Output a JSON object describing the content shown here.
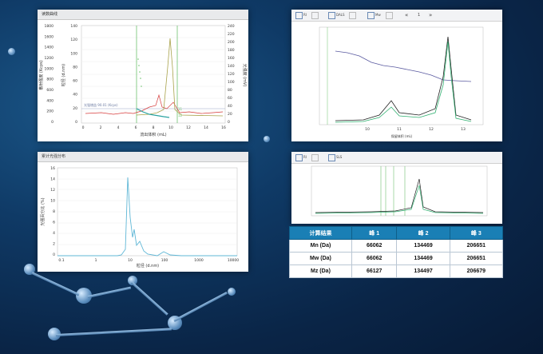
{
  "panels": {
    "chromatogram": {
      "title": "读数曲线",
      "left_axis_label": "散射强度 (Kcps)",
      "mid_axis_label": "粒径 (d.nm)",
      "right_axis_label": "光强度 (mV)",
      "x_label": "流出体积 (mL)",
      "legend_text": "光强增益 90.01 (Kcps)",
      "left_ticks": [
        "1800",
        "1600",
        "1400",
        "1200",
        "1000",
        "800",
        "600",
        "400",
        "200",
        "0"
      ],
      "mid_ticks": [
        "140",
        "120",
        "100",
        "80",
        "60",
        "40",
        "20",
        "0"
      ],
      "right_ticks": [
        "240",
        "220",
        "200",
        "180",
        "160",
        "140",
        "120",
        "100",
        "80",
        "60",
        "40",
        "20",
        "0"
      ],
      "x_ticks": [
        "0",
        "2",
        "4",
        "6",
        "8",
        "10",
        "12",
        "14",
        "16"
      ],
      "marker_1": "11",
      "marker_2": "12"
    },
    "distribution": {
      "title": "累计光强分布",
      "y_label": "光强百分比 (%)",
      "x_label": "粒径 (d.nm)",
      "y_ticks": [
        "16",
        "14",
        "12",
        "10",
        "8",
        "6",
        "4",
        "2",
        "0"
      ],
      "x_ticks": [
        "0.1",
        "1",
        "10",
        "100",
        "1000",
        "10000"
      ]
    },
    "multi_detector": {
      "toolbar": [
        "RI",
        "",
        "DALS",
        "",
        "Mw",
        "",
        "«",
        "1",
        "»"
      ],
      "x_label": "保留体积 (mL)",
      "x_ticks": [
        "10",
        "11",
        "12",
        "13"
      ]
    },
    "small_chart": {
      "toolbar": [
        "RI",
        "",
        "SLS"
      ]
    }
  },
  "results": {
    "headers": [
      "计算结果",
      "峰 1",
      "峰 2",
      "峰 3"
    ],
    "rows": [
      [
        "Mn (Da)",
        "66062",
        "134469",
        "206651"
      ],
      [
        "Mw (Da)",
        "66062",
        "134469",
        "206651"
      ],
      [
        "Mz (Da)",
        "66127",
        "134497",
        "206679"
      ]
    ]
  },
  "colors": {
    "table_header": "#1a7fb5",
    "accent": "#6ec16e",
    "trace_red": "#d63b3b",
    "trace_teal": "#2aa3a0"
  }
}
